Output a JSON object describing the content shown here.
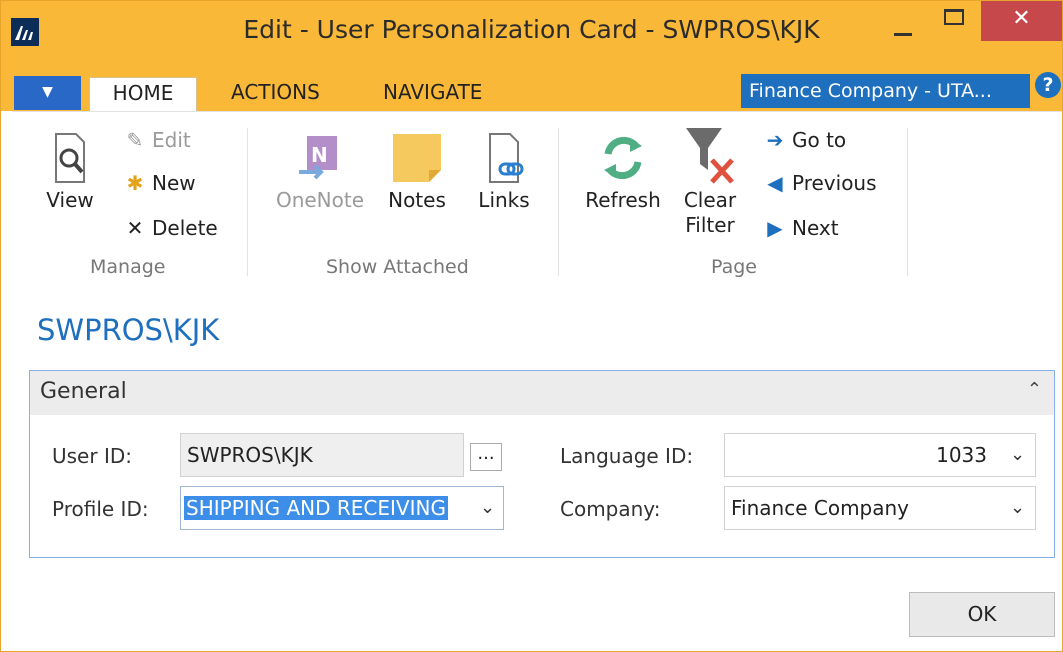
{
  "window": {
    "title": "Edit - User Personalization Card - SWPROS\\KJK",
    "close_glyph": "✕",
    "minimize_icon": "minimize-icon",
    "maximize_icon": "maximize-icon"
  },
  "tabs": {
    "app_menu_glyph": "▼",
    "items": [
      "HOME",
      "ACTIONS",
      "NAVIGATE"
    ],
    "company_indicator": "Finance Company - UTA...",
    "help_glyph": "?"
  },
  "ribbon": {
    "manage": {
      "label": "Manage",
      "view": "View",
      "edit": "Edit",
      "new": "New",
      "delete": "Delete"
    },
    "show_attached": {
      "label": "Show Attached",
      "onenote": "OneNote",
      "notes": "Notes",
      "links": "Links"
    },
    "page": {
      "label": "Page",
      "refresh": "Refresh",
      "clear_filter_1": "Clear",
      "clear_filter_2": "Filter",
      "go_to": "Go to",
      "previous": "Previous",
      "next": "Next"
    }
  },
  "page": {
    "heading": "SWPROS\\KJK"
  },
  "general": {
    "title": "General",
    "collapse_glyph": "⌃",
    "user_id_label": "User ID:",
    "user_id_value": "SWPROS\\KJK",
    "assist_glyph": "...",
    "profile_id_label": "Profile ID:",
    "profile_id_value": "SHIPPING AND RECEIVING",
    "language_id_label": "Language ID:",
    "language_id_value": "1033",
    "company_label": "Company:",
    "company_value": "Finance Company"
  },
  "footer": {
    "ok": "OK"
  },
  "colors": {
    "title_bar": "#f9b838",
    "accent_blue": "#1f6fbf",
    "close_red": "#c7484b",
    "selection": "#3d8ee8"
  }
}
